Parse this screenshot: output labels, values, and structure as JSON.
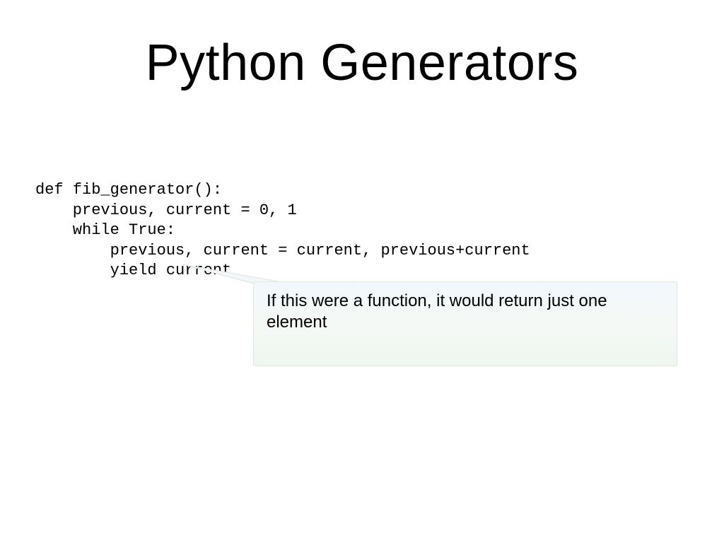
{
  "title": "Python Generators",
  "code": {
    "line1": "def fib_generator():",
    "line2": "    previous, current = 0, 1",
    "line3": "    while True:",
    "line4": "        previous, current = current, previous+current",
    "line5": "        yield current"
  },
  "callout_text": "If this were a function, it would return just one element"
}
